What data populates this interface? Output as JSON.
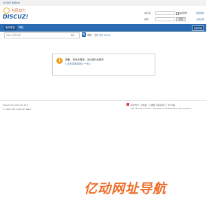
{
  "topbar": {
    "left_links": [
      "设为首页",
      "收藏本站"
    ],
    "right_link": ""
  },
  "logo": {
    "word": "DISCUZ!",
    "cn": "社区动力"
  },
  "login": {
    "user_label": "用户名",
    "pass_label": "密码",
    "auto_login": "自动登录",
    "forgot": "找回密码",
    "login_button": "登录",
    "register": "立即注册"
  },
  "nav": {
    "items": [
      "版块首页",
      "导航"
    ],
    "quick_nav": "快捷导航"
  },
  "search": {
    "placeholder": "请输入搜索内容",
    "type": "帖子",
    "hot_label": "热搜:",
    "hot_terms": [
      "活动",
      "交友",
      "discuz"
    ]
  },
  "message": {
    "text": "抱歉，您尚未登录，无法进行此操作",
    "link": "[ 点击这里返回上一页 ]"
  },
  "footer": {
    "powered": "Powered by Discuz! X3.4",
    "copyright": "© 2001-2017 Discuz! Team.",
    "links": "站长统计 | 手机版 | 小黑屋 | 联系我们 | 京ICP备",
    "gmt": "GMT+8, 2024-4-3 08:37 , Processed in 0.033596 second(s), 6 queries ."
  },
  "watermark": "亿动网址导航"
}
